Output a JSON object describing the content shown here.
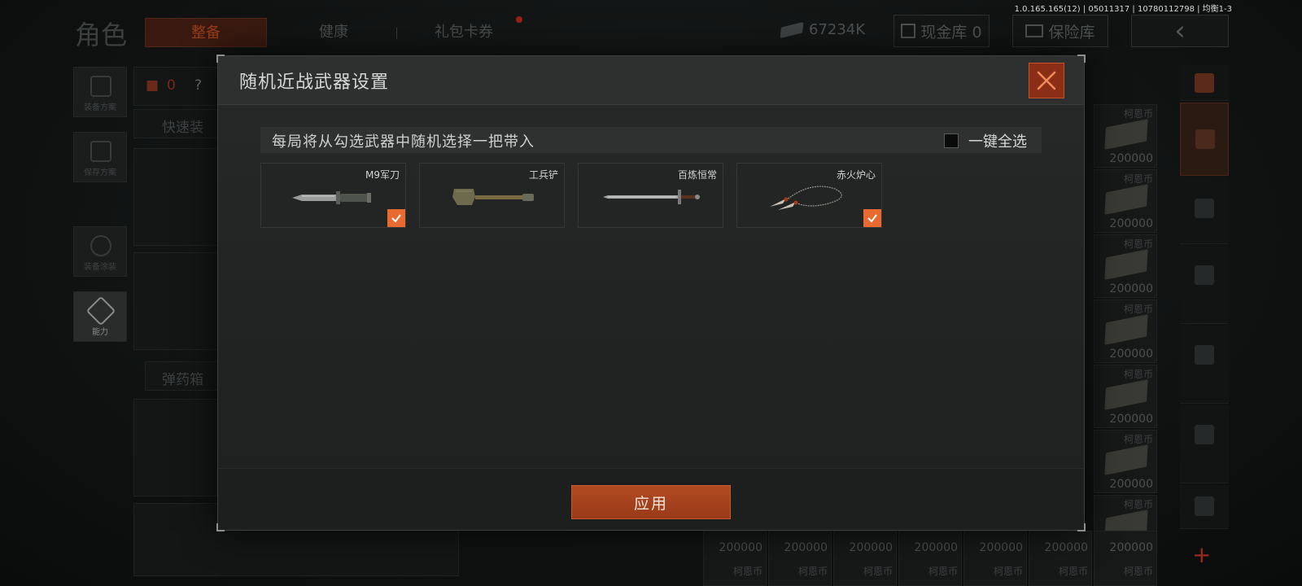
{
  "version": "1.0.165.165(12) | 05011317 | 10780112798 | 均衡1-3",
  "background": {
    "page_title": "角色",
    "tabs": [
      {
        "label": "整备",
        "active": true
      },
      {
        "label": "健康",
        "active": false
      },
      {
        "label": "礼包卡券",
        "active": false,
        "has_notification": true
      }
    ],
    "currency_amount": "67234K",
    "cash_vault_label": "现金库 0",
    "insurance_label": "保险库",
    "side_menu": [
      {
        "label": "装备方案",
        "icon": "backpack-icon"
      },
      {
        "label": "保存方案",
        "icon": "download-icon"
      },
      {
        "label": "装备涂装",
        "icon": "helmet-icon"
      },
      {
        "label": "能力",
        "icon": "lightning-icon",
        "active": true
      }
    ],
    "loadout": {
      "armor_count": "0",
      "help": "?",
      "quick_equip_label": "快速装",
      "ammo_label": "弹药箱"
    },
    "stash": {
      "currency_name": "柯恩币",
      "stack_amount": "200000"
    }
  },
  "modal": {
    "title": "随机近战武器设置",
    "description": "每局将从勾选武器中随机选择一把带入",
    "select_all_label": "一键全选",
    "select_all_checked": false,
    "weapons": [
      {
        "name": "M9军刀",
        "icon": "bayonet-icon",
        "checked": true
      },
      {
        "name": "工兵铲",
        "icon": "shovel-icon",
        "checked": false
      },
      {
        "name": "百炼恒常",
        "icon": "longsword-icon",
        "checked": false
      },
      {
        "name": "赤火炉心",
        "icon": "rope-dart-icon",
        "checked": true
      }
    ],
    "apply_label": "应用"
  },
  "colors": {
    "accent": "#e86a30",
    "button": "#a8431e",
    "close_button": "#8a2e15"
  }
}
